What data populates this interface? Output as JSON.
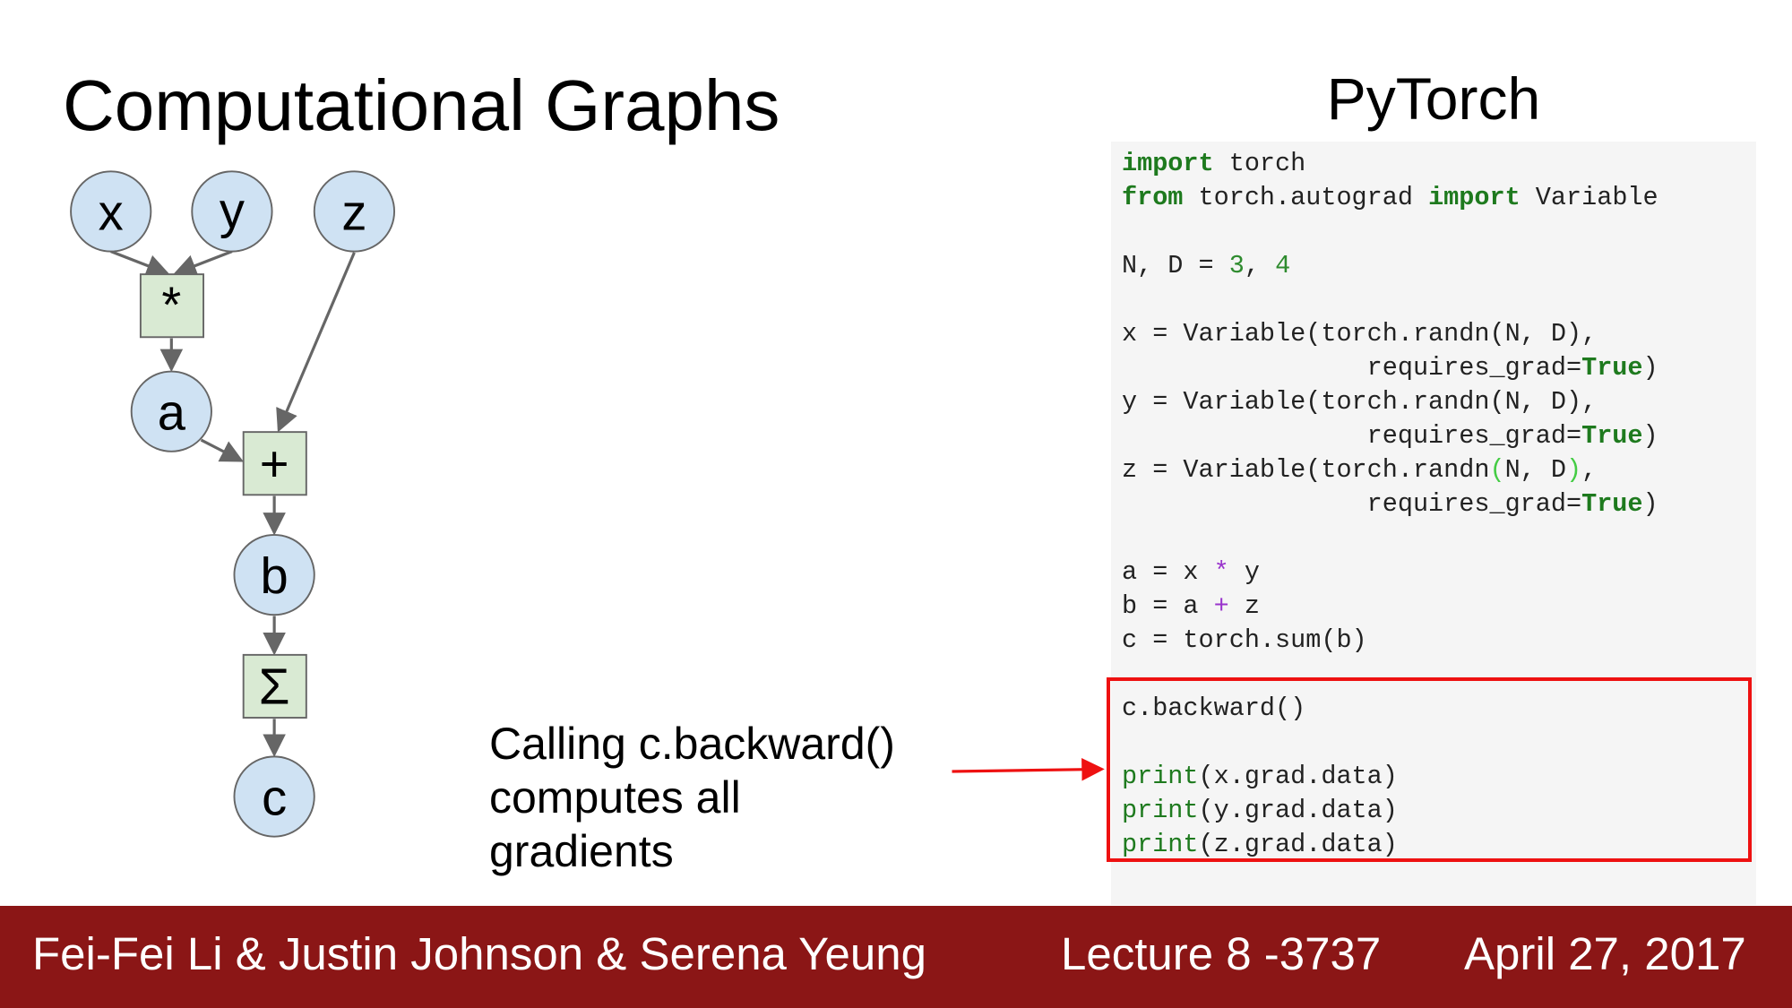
{
  "title": "Computational Graphs",
  "code_title": "PyTorch",
  "graph": {
    "nodes": {
      "x": "x",
      "y": "y",
      "z": "z",
      "mul": "*",
      "a": "a",
      "add": "+",
      "b": "b",
      "sum": "Σ",
      "c": "c"
    }
  },
  "annotation": {
    "lines": [
      "Calling c.backward()",
      "computes all",
      "gradients"
    ]
  },
  "code": {
    "lines": [
      [
        [
          "import",
          "kw"
        ],
        [
          " torch",
          ""
        ]
      ],
      [
        [
          "from",
          "kw"
        ],
        [
          " torch.autograd ",
          ""
        ],
        [
          "import",
          "kw"
        ],
        [
          " Variable",
          ""
        ]
      ],
      [],
      [
        [
          "N, D = ",
          ""
        ],
        [
          "3",
          "num"
        ],
        [
          ", ",
          ""
        ],
        [
          "4",
          "num"
        ]
      ],
      [],
      [
        [
          "x = Variable(torch.randn(N, D),",
          ""
        ]
      ],
      [
        [
          "                requires_grad=",
          ""
        ],
        [
          "True",
          "kw"
        ],
        [
          ")",
          ""
        ]
      ],
      [
        [
          "y = Variable(torch.randn(N, D),",
          ""
        ]
      ],
      [
        [
          "                requires_grad=",
          ""
        ],
        [
          "True",
          "kw"
        ],
        [
          ")",
          ""
        ]
      ],
      [
        [
          "z = Variable(torch.randn",
          ""
        ],
        [
          "(",
          "par"
        ],
        [
          "N, D",
          ""
        ],
        [
          ")",
          "par"
        ],
        [
          ",",
          ""
        ]
      ],
      [
        [
          "                requires_grad=",
          ""
        ],
        [
          "True",
          "kw"
        ],
        [
          ")",
          ""
        ]
      ],
      [],
      [
        [
          "a = x ",
          ""
        ],
        [
          "*",
          "op"
        ],
        [
          " y",
          ""
        ]
      ],
      [
        [
          "b = a ",
          ""
        ],
        [
          "+",
          "op"
        ],
        [
          " z",
          ""
        ]
      ],
      [
        [
          "c = torch.sum(b)",
          ""
        ]
      ],
      [],
      [
        [
          "c.backward()",
          ""
        ]
      ],
      [],
      [
        [
          "print",
          "fn"
        ],
        [
          "(x.grad.data)",
          ""
        ]
      ],
      [
        [
          "print",
          "fn"
        ],
        [
          "(y.grad.data)",
          ""
        ]
      ],
      [
        [
          "print",
          "fn"
        ],
        [
          "(z.grad.data)",
          ""
        ]
      ]
    ]
  },
  "footer": {
    "authors": "Fei-Fei Li & Justin Johnson & Serena Yeung",
    "lecture": "Lecture 8 -3737",
    "date": "April 27, 2017"
  },
  "colors": {
    "footer": "#8b1616",
    "highlight": "#ee1111",
    "node_fill": "#cfe2f3",
    "op_fill": "#d9ead3"
  }
}
